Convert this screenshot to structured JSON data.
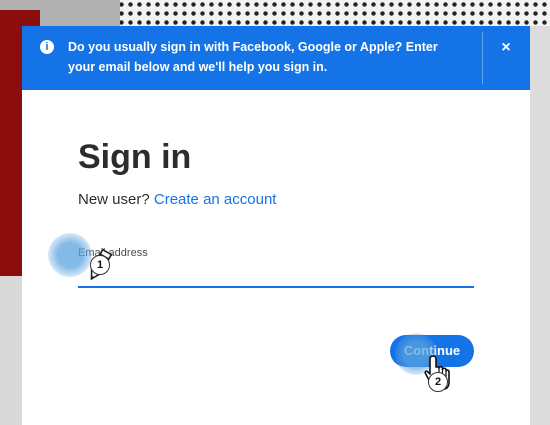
{
  "banner": {
    "icon": "info-icon",
    "message": "Do you usually sign in with Facebook, Google or Apple? Enter your email below and we'll help you sign in.",
    "close_glyph": "×"
  },
  "signin": {
    "title": "Sign in",
    "new_user_text": "New user?",
    "create_account_link": "Create an account",
    "email_label": "Email address",
    "email_value": "",
    "continue_label": "Continue"
  },
  "annotations": {
    "step1": "1",
    "step2": "2"
  },
  "colors": {
    "accent": "#1473e6",
    "text": "#2c2c2c"
  }
}
